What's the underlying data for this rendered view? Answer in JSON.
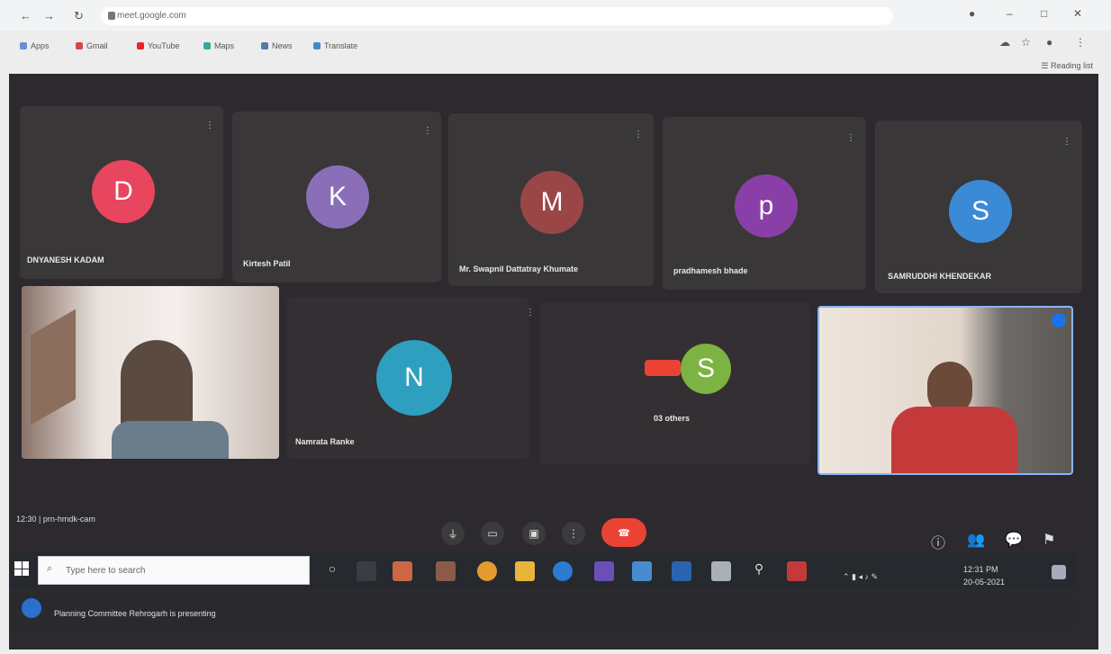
{
  "browser": {
    "url": "meet.google.com",
    "bookmarks": [
      "Apps",
      "Gmail",
      "YouTube",
      "Maps",
      "News",
      "Translate"
    ],
    "reading_list": "Reading list"
  },
  "participants_top": [
    {
      "initial": "D",
      "name": "DNYANESH KADAM",
      "color": "#e8455e"
    },
    {
      "initial": "K",
      "name": "Kirtesh Patil",
      "color": "#8a6fb8"
    },
    {
      "initial": "M",
      "name": "Mr. Swapnil Dattatray Khumate",
      "color": "#9b4646"
    },
    {
      "initial": "p",
      "name": "pradhamesh bhade",
      "color": "#8a3fa8"
    },
    {
      "initial": "S",
      "name": "SAMRUDDHI KHENDEKAR",
      "color": "#3b8ad6"
    }
  ],
  "participants_bottom": [
    {
      "initial": "N",
      "name": "Namrata Ranke",
      "color": "#2f9fbf"
    },
    {
      "initial": "S",
      "name": "03 others",
      "color": "#7cb342"
    }
  ],
  "meeting": {
    "time": "12:30",
    "code": "prn-hmdk-cam"
  },
  "taskbar": {
    "search_placeholder": "Type here to search",
    "clock_time": "12:31 PM",
    "clock_date": "20-05-2021"
  },
  "presenting": "Planning Committee Rehrogarh is presenting"
}
